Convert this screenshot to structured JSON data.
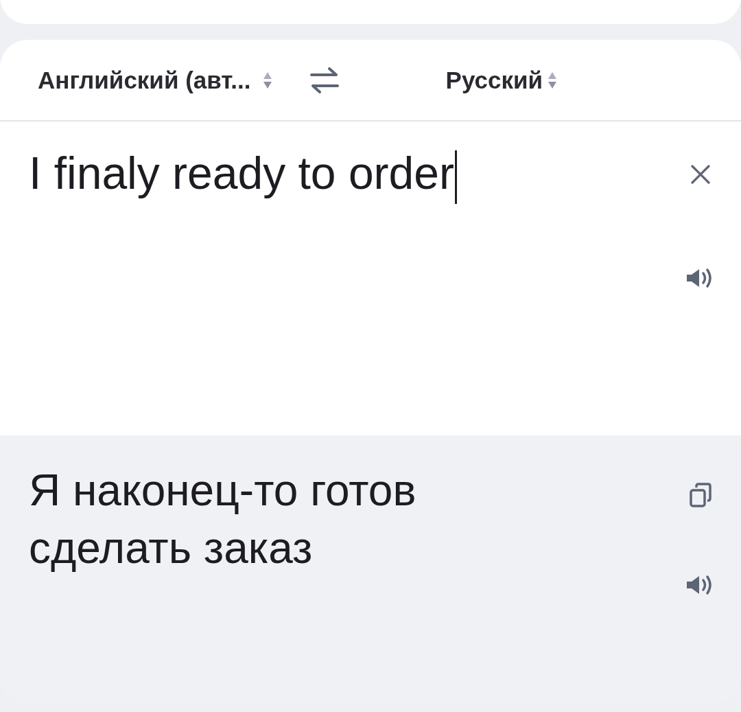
{
  "languages": {
    "source": "Английский (авт...",
    "target": "Русский"
  },
  "input": {
    "value": "I finaly ready to order"
  },
  "output": {
    "text": "Я наконец-то готов сделать заказ"
  }
}
